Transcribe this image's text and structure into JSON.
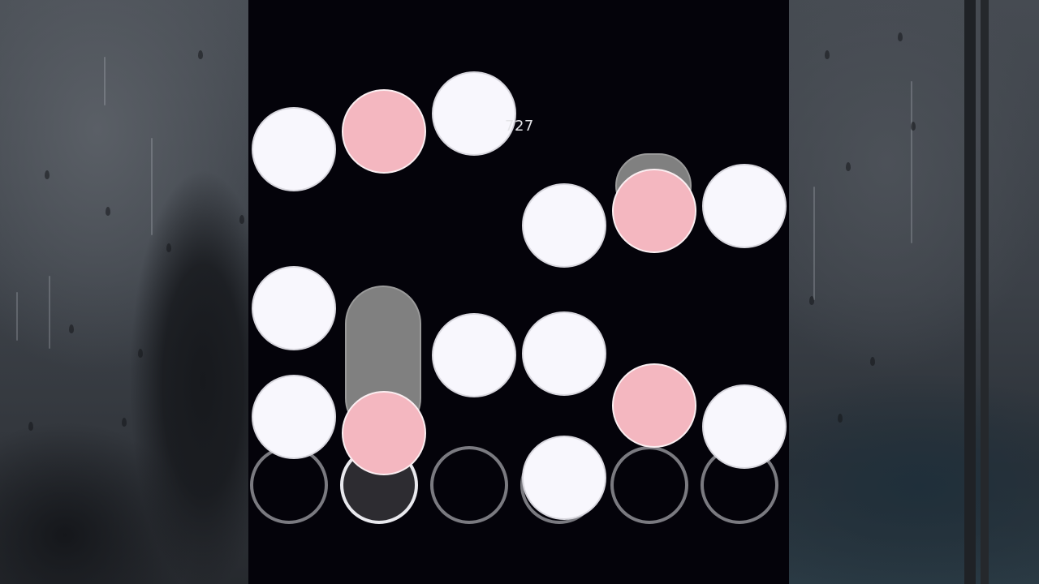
{
  "combo_counter": "727",
  "colors": {
    "playfield": "#04030a",
    "note_white": "#f8f7fd",
    "note_pink": "#f4b7c0",
    "hold_body": "#808080",
    "receptor_ring": "#7a7a80",
    "receptor_pressed": "#2d2c31"
  },
  "lanes": [
    {
      "id": 1,
      "pressed": false
    },
    {
      "id": 2,
      "pressed": true
    },
    {
      "id": 3,
      "pressed": false
    },
    {
      "id": 4,
      "pressed": false
    },
    {
      "id": 5,
      "pressed": false
    },
    {
      "id": 6,
      "pressed": false
    }
  ],
  "notes": [
    {
      "lane": 1,
      "color": "white",
      "type": "tap"
    },
    {
      "lane": 2,
      "color": "pink",
      "type": "tap"
    },
    {
      "lane": 3,
      "color": "white",
      "type": "tap"
    },
    {
      "lane": 4,
      "color": "white",
      "type": "tap"
    },
    {
      "lane": 5,
      "color": "pink",
      "type": "hold"
    },
    {
      "lane": 6,
      "color": "white",
      "type": "tap"
    },
    {
      "lane": 1,
      "color": "white",
      "type": "tap"
    },
    {
      "lane": 3,
      "color": "white",
      "type": "tap"
    },
    {
      "lane": 4,
      "color": "white",
      "type": "tap"
    },
    {
      "lane": 1,
      "color": "white",
      "type": "tap"
    },
    {
      "lane": 2,
      "color": "pink",
      "type": "hold"
    },
    {
      "lane": 5,
      "color": "pink",
      "type": "tap"
    },
    {
      "lane": 6,
      "color": "white",
      "type": "tap"
    },
    {
      "lane": 4,
      "color": "white",
      "type": "tap"
    }
  ]
}
